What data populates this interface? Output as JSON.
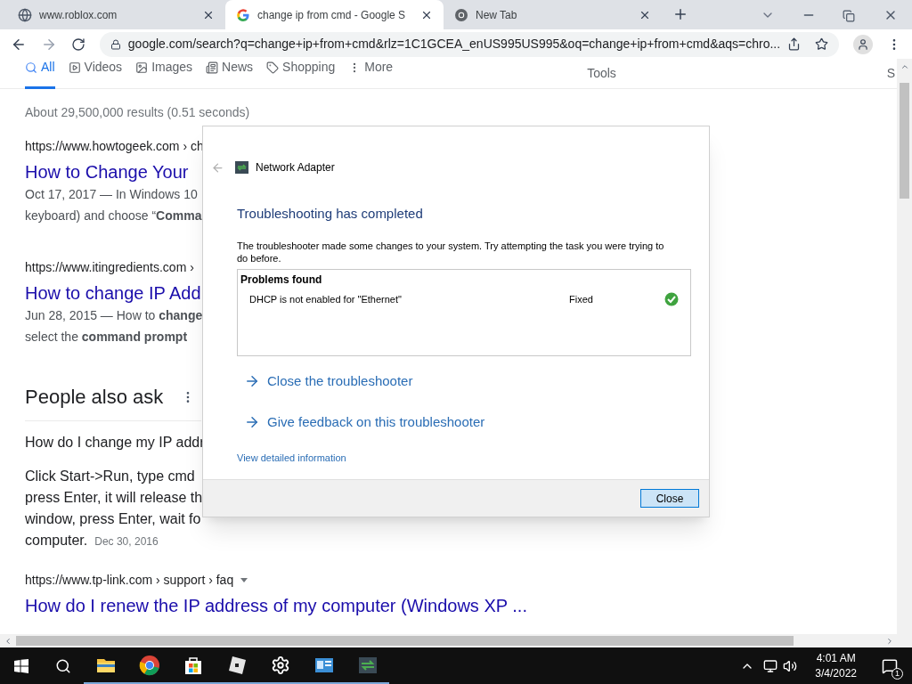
{
  "browser": {
    "tabs": [
      {
        "title": "www.roblox.com",
        "selected": false
      },
      {
        "title": "change ip from cmd - Google S",
        "selected": true
      },
      {
        "title": "New Tab",
        "selected": false
      }
    ],
    "address": "google.com/search?q=change+ip+from+cmd&rlz=1C1GCEA_enUS995US995&oq=change+ip+from+cmd&aqs=chro..."
  },
  "search_tabs": [
    {
      "label": "All",
      "selected": true
    },
    {
      "label": "Videos",
      "selected": false
    },
    {
      "label": "Images",
      "selected": false
    },
    {
      "label": "News",
      "selected": false
    },
    {
      "label": "Shopping",
      "selected": false
    },
    {
      "label": "More",
      "selected": false
    }
  ],
  "tools_label": "Tools",
  "cut_label": "S",
  "result_stats": "About 29,500,000 results (0.51 seconds)",
  "results": [
    {
      "url": "https://www.howtogeek.com › ch",
      "title": "How to Change Your",
      "snippet": [
        "Oct 17, 2017 — In Windows 10",
        "keyboard) and choose “**Comma**"
      ]
    },
    {
      "url": "https://www.itingredients.com ›",
      "title": "How to change IP Add",
      "snippet": [
        "Jun 28, 2015 — How to **change**",
        "select the **command prompt**"
      ]
    }
  ],
  "people_also_ask": {
    "heading": "People also ask",
    "question": "How do I change my IP addr",
    "answer": [
      "Click Start->Run, type cmd",
      "press Enter, it will release th",
      "window, press Enter, wait fo",
      "computer."
    ],
    "date": "Dec 30, 2016"
  },
  "last_result": {
    "url": "https://www.tp-link.com › support › faq",
    "title": "How do I renew the IP address of my computer (Windows XP ..."
  },
  "dialog": {
    "title": "Network Adapter",
    "heading": "Troubleshooting has completed",
    "message": "The troubleshooter made some changes to your system. Try attempting the task you were trying to do before.",
    "problems_heading": "Problems found",
    "problems": [
      {
        "name": "DHCP is not enabled for \"Ethernet\"",
        "status": "Fixed",
        "fixed": true
      }
    ],
    "actions": [
      "Close the troubleshooter",
      "Give feedback on this troubleshooter"
    ],
    "details_link": "View detailed information",
    "close_button": "Close"
  },
  "taskbar": {
    "time": "4:01 AM",
    "date": "3/4/2022",
    "notifications": "1"
  }
}
